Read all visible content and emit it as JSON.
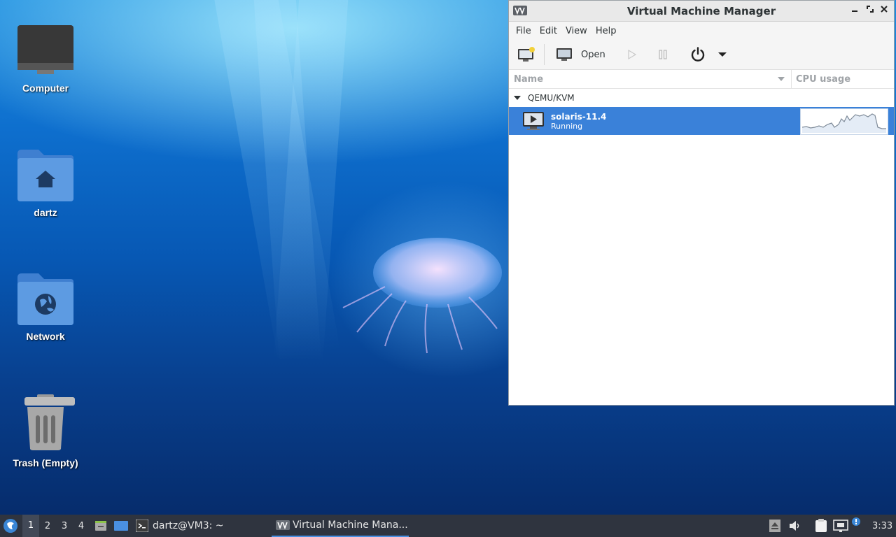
{
  "desktop": {
    "icons": [
      {
        "label": "Computer",
        "icon": "computer-icon"
      },
      {
        "label": "dartz",
        "icon": "home-folder-icon"
      },
      {
        "label": "Network",
        "icon": "network-folder-icon"
      },
      {
        "label": "Trash (Empty)",
        "icon": "trash-icon"
      }
    ]
  },
  "window": {
    "title": "Virtual Machine Manager",
    "controls": [
      "minimize",
      "maximize",
      "close"
    ],
    "menu": [
      "File",
      "Edit",
      "View",
      "Help"
    ],
    "toolbar": {
      "new_vm_icon": "new-vm-icon",
      "open_label": "Open",
      "run_icon": "play-icon",
      "pause_icon": "pause-icon",
      "shutdown_icon": "power-icon",
      "menu_icon": "dropdown-arrow-icon"
    },
    "columns": {
      "name": "Name",
      "cpu": "CPU usage"
    },
    "group": {
      "name": "QEMU/KVM",
      "expanded": true
    },
    "vms": [
      {
        "name": "solaris-11.4",
        "status": "Running",
        "selected": true
      }
    ],
    "accent_color": "#3a81d9"
  },
  "taskbar": {
    "workspaces": [
      "1",
      "2",
      "3",
      "4"
    ],
    "active_workspace": "1",
    "tasks": [
      {
        "label": "dartz@VM3: ~",
        "icon": "terminal-icon"
      },
      {
        "label": "Virtual Machine Mana...",
        "icon": "vmm-icon",
        "active": true
      }
    ],
    "clock": "3:33"
  }
}
